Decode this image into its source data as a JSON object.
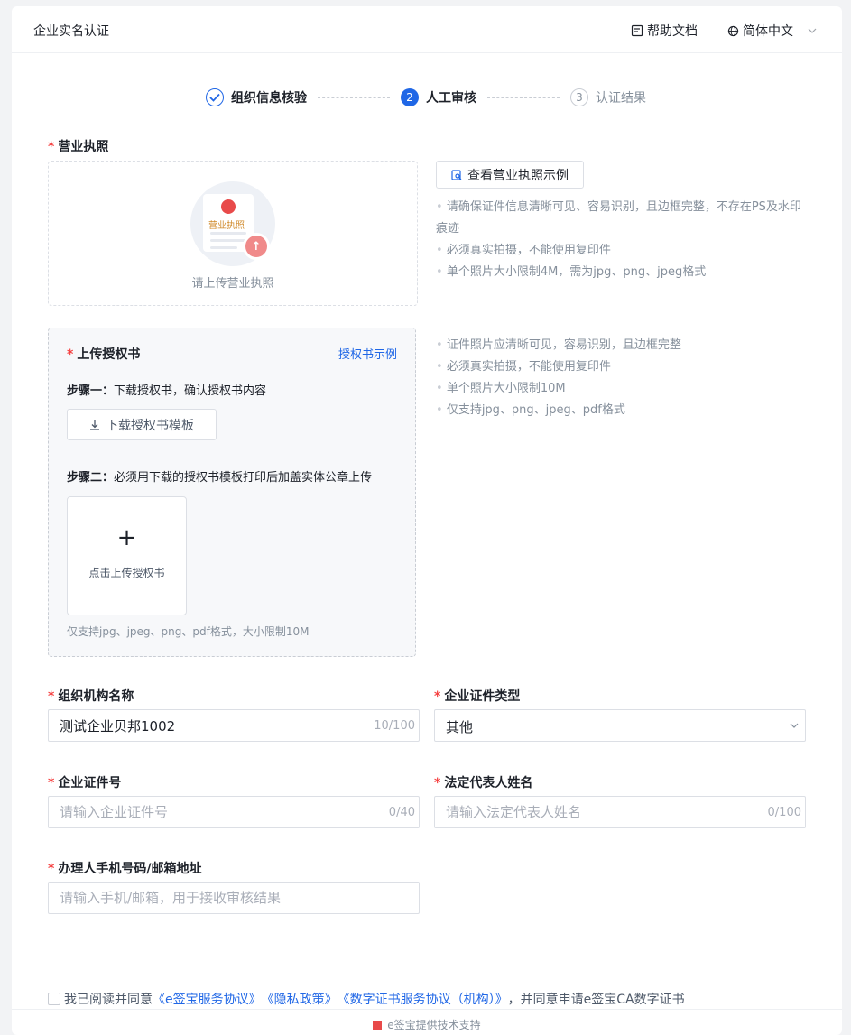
{
  "header": {
    "title": "企业实名认证",
    "help_label": "帮助文档",
    "lang_label": "简体中文"
  },
  "steps": [
    {
      "num": "1",
      "label": "组织信息核验",
      "state": "done"
    },
    {
      "num": "2",
      "label": "人工审核",
      "state": "active"
    },
    {
      "num": "3",
      "label": "认证结果",
      "state": "wait"
    }
  ],
  "license": {
    "label": "营业执照",
    "icon_text": "营业执照",
    "upload_caption": "请上传营业执照",
    "example_button": "查看营业执照示例",
    "tips": [
      "请确保证件信息清晰可见、容易识别，且边框完整，不存在PS及水印痕迹",
      "必须真实拍摄，不能使用复印件",
      "单个照片大小限制4M，需为jpg、png、jpeg格式"
    ]
  },
  "authorization": {
    "label": "上传授权书",
    "example_link": "授权书示例",
    "step1_prefix": "步骤一：",
    "step1_text": "下载授权书，确认授权书内容",
    "download_button": "下载授权书模板",
    "step2_prefix": "步骤二：",
    "step2_text": "必须用下载的授权书模板打印后加盖实体公章上传",
    "upload_plus": "+",
    "upload_caption": "点击上传授权书",
    "note": "仅支持jpg、jpeg、png、pdf格式，大小限制10M",
    "tips": [
      "证件照片应清晰可见，容易识别，且边框完整",
      "必须真实拍摄，不能使用复印件",
      "单个照片大小限制10M",
      "仅支持jpg、png、jpeg、pdf格式"
    ]
  },
  "form": {
    "org_name": {
      "label": "组织机构名称",
      "value": "测试企业贝邦1002",
      "count": "10/100"
    },
    "cert_type": {
      "label": "企业证件类型",
      "value": "其他"
    },
    "cert_no": {
      "label": "企业证件号",
      "placeholder": "请输入企业证件号",
      "count": "0/40"
    },
    "legal_rep": {
      "label": "法定代表人姓名",
      "placeholder": "请输入法定代表人姓名",
      "count": "0/100"
    },
    "contact": {
      "label": "办理人手机号码/邮箱地址",
      "placeholder": "请输入手机/邮箱，用于接收审核结果"
    }
  },
  "agreement": {
    "prefix": "我已阅读并同意",
    "link1": "《e签宝服务协议》",
    "link2": "《隐私政策》",
    "link3": "《数字证书服务协议（机构）》",
    "suffix": "，并同意申请e签宝CA数字证书"
  },
  "footer": {
    "text": "e签宝提供技术支持"
  },
  "colors": {
    "primary": "#2067e6",
    "required": "#f53f3f"
  }
}
